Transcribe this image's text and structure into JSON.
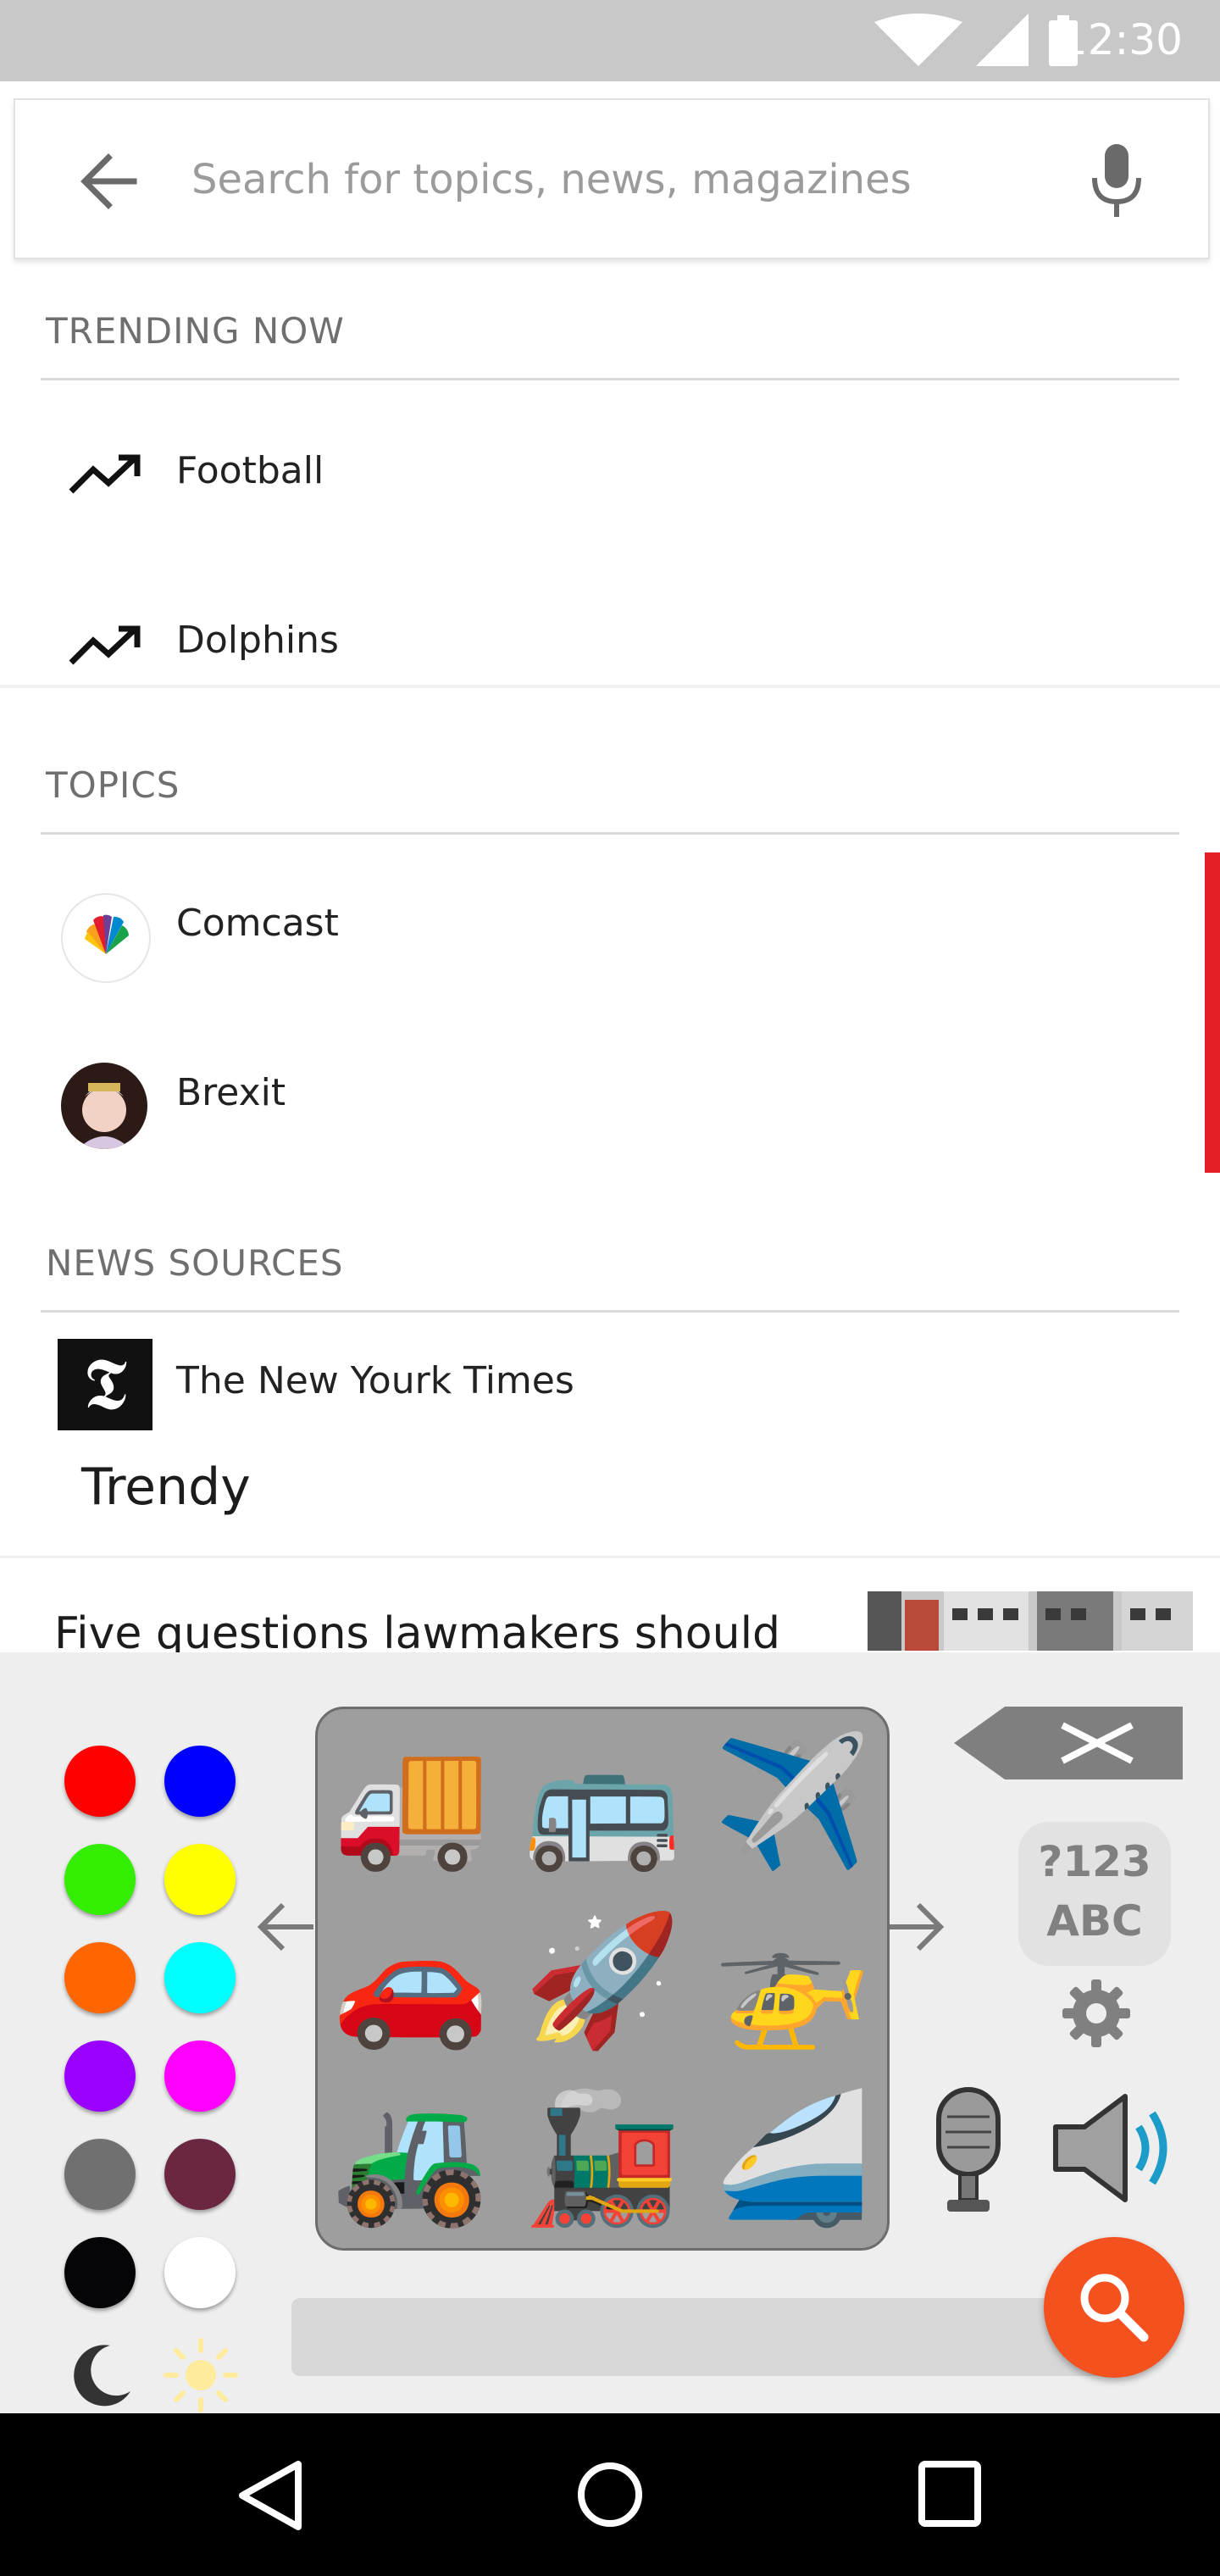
{
  "status_bar": {
    "time": "12:30"
  },
  "search": {
    "placeholder": "Search for topics, news, magazines"
  },
  "trending": {
    "header": "TRENDING NOW",
    "items": [
      {
        "label": "Football",
        "icon": "trending-up-icon"
      },
      {
        "label": "Dolphins",
        "icon": "trending-up-icon"
      }
    ]
  },
  "topics": {
    "header": "TOPICS",
    "items": [
      {
        "label": "Comcast",
        "icon": "nbc-peacock-icon"
      },
      {
        "label": "Brexit",
        "icon": "queen-portrait-avatar"
      }
    ]
  },
  "news_sources": {
    "header": "NEWS SOURCES",
    "items": [
      {
        "label": "The New Yourk Times",
        "icon": "nyt-logo-icon",
        "logo_text": "𝕿"
      }
    ]
  },
  "feed": {
    "title": "Trendy",
    "story_headline": "Five questions lawmakers should"
  },
  "keyboard": {
    "colors": [
      "#ff0000",
      "#0000ff",
      "#33ee00",
      "#ffff00",
      "#ff6600",
      "#00ffff",
      "#9900ff",
      "#ff00ff",
      "#707070",
      "#6b2642",
      "#050508",
      "#ffffff"
    ],
    "emojis": [
      "🚚",
      "🚌",
      "✈️",
      "🚗",
      "🚀",
      "🚁",
      "🚜",
      "🚂",
      "🚄"
    ],
    "mode_key_line1": "?123",
    "mode_key_line2": "ABC",
    "moon_icon": "moon-icon",
    "sun_icon": "sun-icon",
    "delete_icon": "backspace-icon",
    "settings_icon": "gear-icon",
    "mic_icon": "microphone-icon",
    "speaker_icon": "speaker-icon",
    "fab_icon": "search-icon",
    "accent": "#f4511e"
  }
}
